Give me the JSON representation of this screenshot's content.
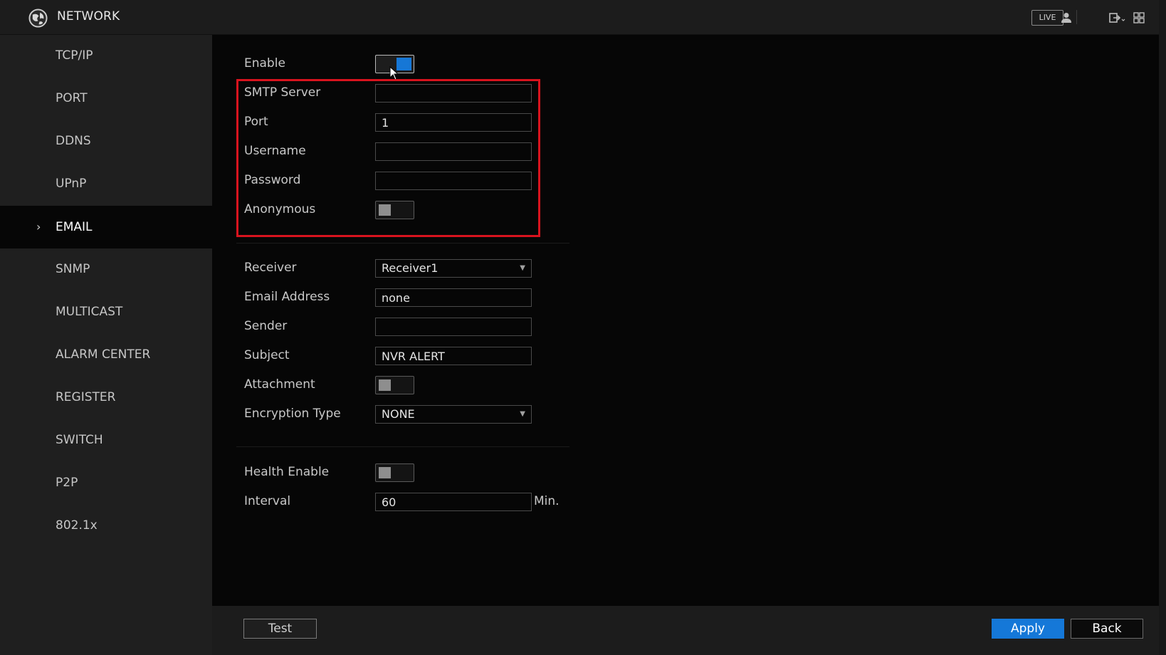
{
  "header": {
    "title": "NETWORK",
    "live_label": "LIVE",
    "icons": [
      "network-logo-icon",
      "user-icon",
      "logout-icon",
      "grid-menu-icon"
    ]
  },
  "sidebar": {
    "items": [
      {
        "label": "TCP/IP"
      },
      {
        "label": "PORT"
      },
      {
        "label": "DDNS"
      },
      {
        "label": "UPnP"
      },
      {
        "label": "EMAIL",
        "active": true
      },
      {
        "label": "SNMP"
      },
      {
        "label": "MULTICAST"
      },
      {
        "label": "ALARM CENTER"
      },
      {
        "label": "REGISTER"
      },
      {
        "label": "SWITCH"
      },
      {
        "label": "P2P"
      },
      {
        "label": "802.1x"
      }
    ],
    "active_chevron": "›"
  },
  "email_form": {
    "enable": {
      "label": "Enable",
      "on": true
    },
    "smtp_server": {
      "label": "SMTP Server",
      "value": ""
    },
    "port": {
      "label": "Port",
      "value": "1"
    },
    "username": {
      "label": "Username",
      "value": ""
    },
    "password": {
      "label": "Password",
      "value": ""
    },
    "anonymous": {
      "label": "Anonymous",
      "on": false
    },
    "receiver": {
      "label": "Receiver",
      "value": "Receiver1"
    },
    "email_address": {
      "label": "Email Address",
      "value": "none"
    },
    "sender": {
      "label": "Sender",
      "value": ""
    },
    "subject": {
      "label": "Subject",
      "value": "NVR ALERT"
    },
    "attachment": {
      "label": "Attachment",
      "on": false
    },
    "encryption_type": {
      "label": "Encryption Type",
      "value": "NONE"
    },
    "health_enable": {
      "label": "Health Enable",
      "on": false
    },
    "interval": {
      "label": "Interval",
      "value": "60",
      "unit": "Min."
    }
  },
  "footer": {
    "test_label": "Test",
    "apply_label": "Apply",
    "back_label": "Back"
  },
  "colors": {
    "accent": "#1578d8",
    "highlight": "#d8131e",
    "sidebar_bg": "#1f1f1f",
    "content_bg": "#060606"
  }
}
